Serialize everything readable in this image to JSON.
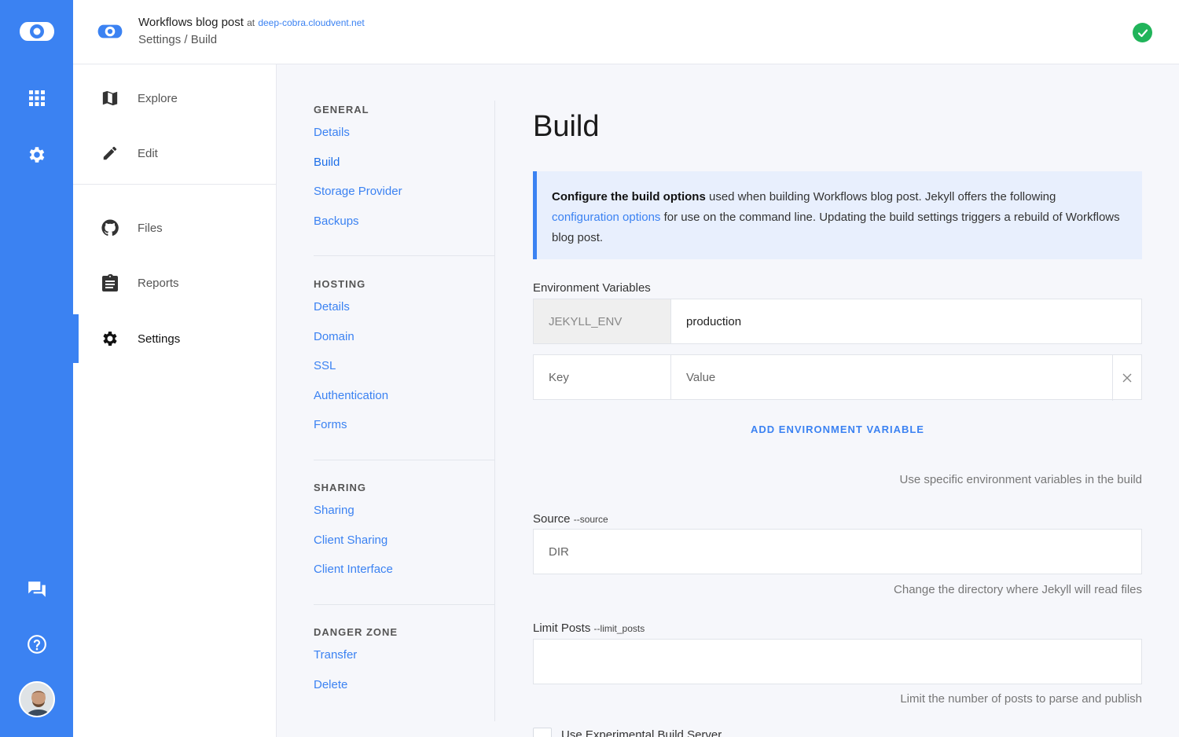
{
  "header": {
    "site_title": "Workflows blog post",
    "at": "at",
    "domain": "deep-cobra.cloudvent.net",
    "breadcrumb": "Settings / Build"
  },
  "rail": {
    "icons": [
      "cloudcannon-logo-icon",
      "apps-grid-icon",
      "gear-icon",
      "chat-icon",
      "help-icon",
      "avatar"
    ]
  },
  "sidenav": {
    "items": [
      {
        "label": "Explore",
        "icon": "map-icon"
      },
      {
        "label": "Edit",
        "icon": "pencil-icon"
      },
      {
        "label": "Files",
        "icon": "github-icon"
      },
      {
        "label": "Reports",
        "icon": "clipboard-icon"
      },
      {
        "label": "Settings",
        "icon": "gear-icon",
        "active": true
      }
    ]
  },
  "settings_menu": {
    "groups": [
      {
        "heading": "GENERAL",
        "links": [
          "Details",
          "Build",
          "Storage Provider",
          "Backups"
        ]
      },
      {
        "heading": "HOSTING",
        "links": [
          "Details",
          "Domain",
          "SSL",
          "Authentication",
          "Forms"
        ]
      },
      {
        "heading": "SHARING",
        "links": [
          "Sharing",
          "Client Sharing",
          "Client Interface"
        ]
      },
      {
        "heading": "DANGER ZONE",
        "links": [
          "Transfer",
          "Delete"
        ]
      }
    ],
    "current": "Build"
  },
  "main": {
    "title": "Build",
    "notice": {
      "bold": "Configure the build options",
      "text1": " used when building Workflows blog post. Jekyll offers the following ",
      "link": "configuration options",
      "text2": " for use on the command line. Updating the build settings triggers a rebuild of Workflows blog post."
    },
    "env": {
      "label": "Environment Variables",
      "rows": [
        {
          "key": "JEKYLL_ENV",
          "value": "production"
        }
      ],
      "new_key_placeholder": "Key",
      "new_value_placeholder": "Value",
      "add_label": "ADD ENVIRONMENT VARIABLE",
      "help": "Use specific environment variables in the build"
    },
    "source": {
      "label": "Source",
      "flag": "--source",
      "placeholder": "DIR",
      "help": "Change the directory where Jekyll will read files"
    },
    "limit_posts": {
      "label": "Limit Posts",
      "flag": "--limit_posts",
      "placeholder": "",
      "help": "Limit the number of posts to parse and publish"
    },
    "experimental": {
      "label": "Use Experimental Build Server"
    }
  },
  "colors": {
    "accent": "#3b82f2",
    "status_ok": "#20b45a"
  }
}
